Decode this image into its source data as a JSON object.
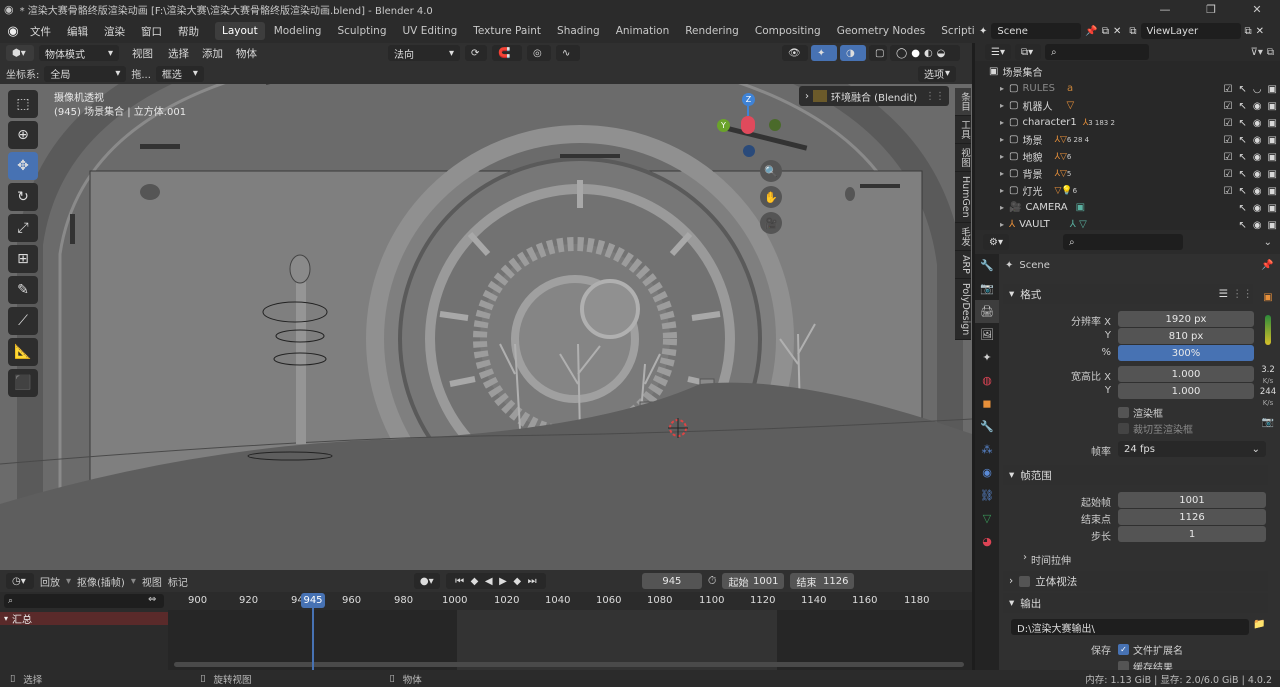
{
  "window": {
    "title": "* 渲染大赛骨骼终版渲染动画 [F:\\渲染大赛\\渲染大赛骨骼终版渲染动画.blend] - Blender 4.0",
    "controls": [
      "—",
      "❐",
      "✕"
    ]
  },
  "menu": [
    "文件",
    "编辑",
    "渲染",
    "窗口",
    "帮助"
  ],
  "workspaces": [
    "Layout",
    "Modeling",
    "Sculpting",
    "UV Editing",
    "Texture Paint",
    "Shading",
    "Animation",
    "Rendering",
    "Compositing",
    "Geometry Nodes",
    "Scripting"
  ],
  "workspace_add": "+",
  "scene_selector": "Scene",
  "view_layer": "ViewLayer",
  "viewport_header": {
    "mode": "物体模式",
    "menus": [
      "视图",
      "选择",
      "添加",
      "物体"
    ],
    "orientation": "法向",
    "options_label": "选项"
  },
  "viewport_header2": {
    "coord_label": "坐标系:",
    "coord_value": "全局",
    "drag_label": "拖...",
    "select_mode": "框选"
  },
  "viewport": {
    "camera_label": "摄像机透视",
    "collection_info": "(945) 场景集合 | 立方体.001",
    "env_label": "环境融合 (Blendit)"
  },
  "sidebar_tabs": [
    "条目",
    "工具",
    "视图",
    "HumGen",
    "毛发",
    "ARP",
    "PolyDesign"
  ],
  "tools": [
    {
      "name": "select-box",
      "glyph": "⬚"
    },
    {
      "name": "cursor",
      "glyph": "⊕"
    },
    {
      "name": "move",
      "glyph": "✥"
    },
    {
      "name": "rotate",
      "glyph": "↻"
    },
    {
      "name": "scale",
      "glyph": "⤢"
    },
    {
      "name": "transform",
      "glyph": "⊞"
    },
    {
      "name": "annotate",
      "glyph": "✎"
    },
    {
      "name": "annotate-line",
      "glyph": "⟋"
    },
    {
      "name": "measure",
      "glyph": "📐"
    },
    {
      "name": "add-cube",
      "glyph": "⬛"
    }
  ],
  "gizmo": {
    "z": "Z",
    "y": "Y"
  },
  "timeline": {
    "playback": "回放",
    "keying": "抠像(插帧)",
    "view": "视图",
    "marker": "标记",
    "current_frame": "945",
    "start_label": "起始",
    "start": "1001",
    "end_label": "结束",
    "end": "1126",
    "ruler": [
      "900",
      "920",
      "94",
      "960",
      "980",
      "1000",
      "1020",
      "1040",
      "1060",
      "1080",
      "1100",
      "1120",
      "1140",
      "1160",
      "1180"
    ],
    "playhead": "945",
    "summary": "汇总"
  },
  "status": {
    "select": "选择",
    "rotate": "旋转视图",
    "object": "物体",
    "stats": "内存: 1.13 GiB | 显存: 2.0/6.0 GiB | 4.0.2"
  },
  "outliner": {
    "root": "场景集合",
    "rows": [
      {
        "label": "RULES",
        "suffix": ""
      },
      {
        "label": "机器人",
        "suffix": ""
      },
      {
        "label": "character1",
        "suffix": "3 183 2"
      },
      {
        "label": "场景",
        "suffix": "6 28 4"
      },
      {
        "label": "地貌",
        "suffix": "6"
      },
      {
        "label": "背景",
        "suffix": "5"
      },
      {
        "label": "灯光",
        "suffix": "6"
      },
      {
        "label": "CAMERA",
        "suffix": ""
      },
      {
        "label": "VAULT",
        "suffix": ""
      }
    ]
  },
  "properties": {
    "context": "Scene",
    "format_panel": "格式",
    "res_x_label": "分辨率 X",
    "res_x": "1920 px",
    "res_y_label": "Y",
    "res_y": "810 px",
    "percent_label": "%",
    "percent": "300%",
    "aspect_x_label": "宽高比 X",
    "aspect_x": "1.000",
    "aspect_y_label": "Y",
    "aspect_y": "1.000",
    "render_region": "渲染框",
    "crop_region": "裁切至渲染框",
    "fps_label": "帧率",
    "fps": "24 fps",
    "frame_range_panel": "帧范围",
    "frame_start_label": "起始帧",
    "frame_start": "1001",
    "frame_end_label": "结束点",
    "frame_end": "1126",
    "step_label": "步长",
    "step": "1",
    "time_stretch": "时间拉伸",
    "stereo": "立体视法",
    "output_panel": "输出",
    "output_path": "D:\\渲染大赛输出\\",
    "save_label": "保存",
    "file_ext": "文件扩展名",
    "cache_result": "缓存结果",
    "side_stats": {
      "a": "3.2",
      "a_unit": "K/s",
      "b": "244",
      "b_unit": "K/s"
    }
  },
  "colors": {
    "accent": "#4772b3",
    "viewport_bg": "#686868",
    "timeline_playhead": "#4772b3",
    "x_axis": "#e04a5c",
    "y_axis": "#6aa32b",
    "z_axis": "#3f83d6"
  }
}
